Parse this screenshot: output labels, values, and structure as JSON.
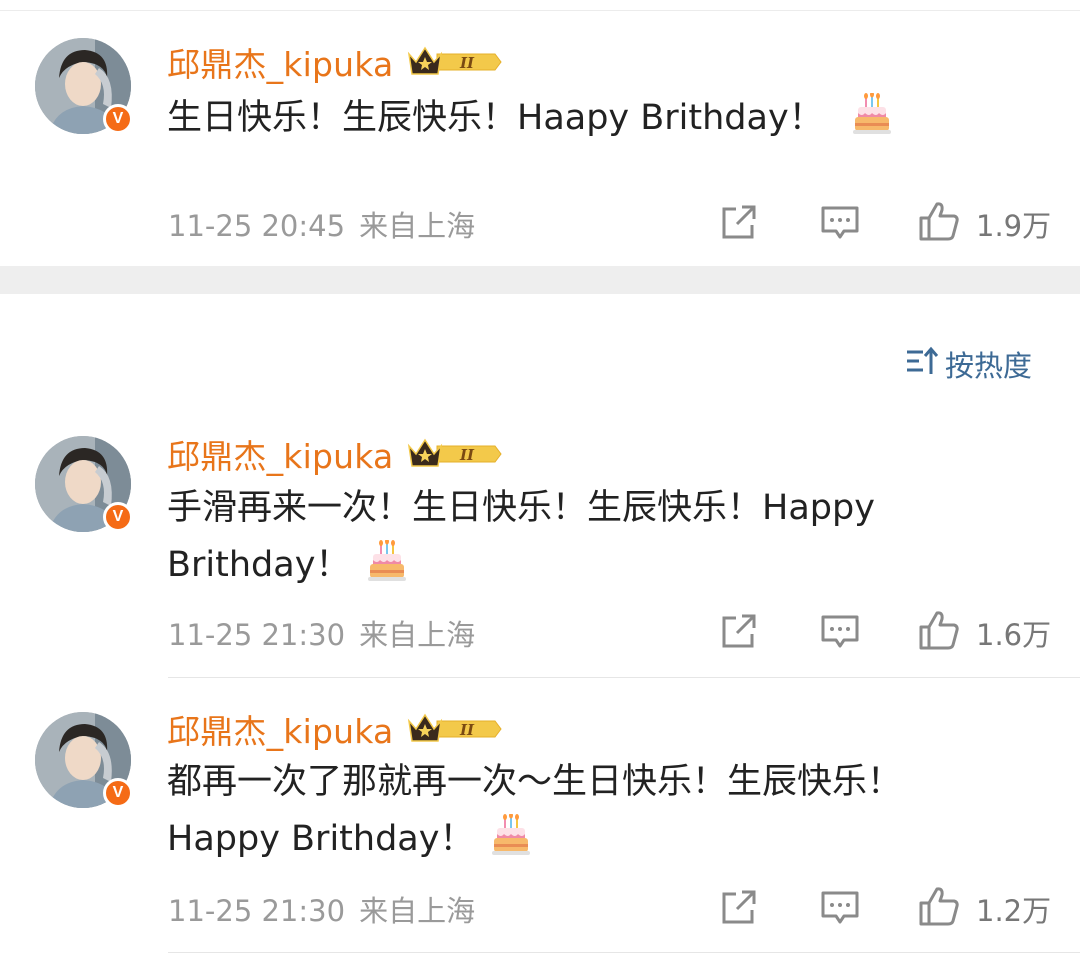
{
  "comments": [
    {
      "username": "邱鼎杰_kipuka",
      "badge_level": "II",
      "text": "生日快乐！生辰快乐！Haapy Brithday！",
      "text_line2": "",
      "time": "11-25 20:45",
      "location": "来自上海",
      "likes": "1.9万"
    },
    {
      "username": "邱鼎杰_kipuka",
      "badge_level": "II",
      "text": "手滑再来一次！生日快乐！生辰快乐！Happy",
      "text_line2": "Brithday！",
      "time": "11-25 21:30",
      "location": "来自上海",
      "likes": "1.6万"
    },
    {
      "username": "邱鼎杰_kipuka",
      "badge_level": "II",
      "text": "都再一次了那就再一次～生日快乐！生辰快乐！",
      "text_line2": "Happy Brithday！",
      "time": "11-25 21:30",
      "location": "来自上海",
      "likes": "1.2万"
    }
  ],
  "sort": {
    "label": "按热度",
    "icon": "sort-icon"
  },
  "verified_mark": "V",
  "icons": {
    "repost": "share-icon",
    "comment": "comment-icon",
    "like": "thumbs-up-icon",
    "emoji": "birthday-cake-emoji",
    "badge": "crown-badge-icon"
  },
  "colors": {
    "username": "#e8751a",
    "verified": "#f56b16",
    "meta": "#9a9a9a",
    "sort": "#3d6a95",
    "separator": "#eeeeee"
  }
}
